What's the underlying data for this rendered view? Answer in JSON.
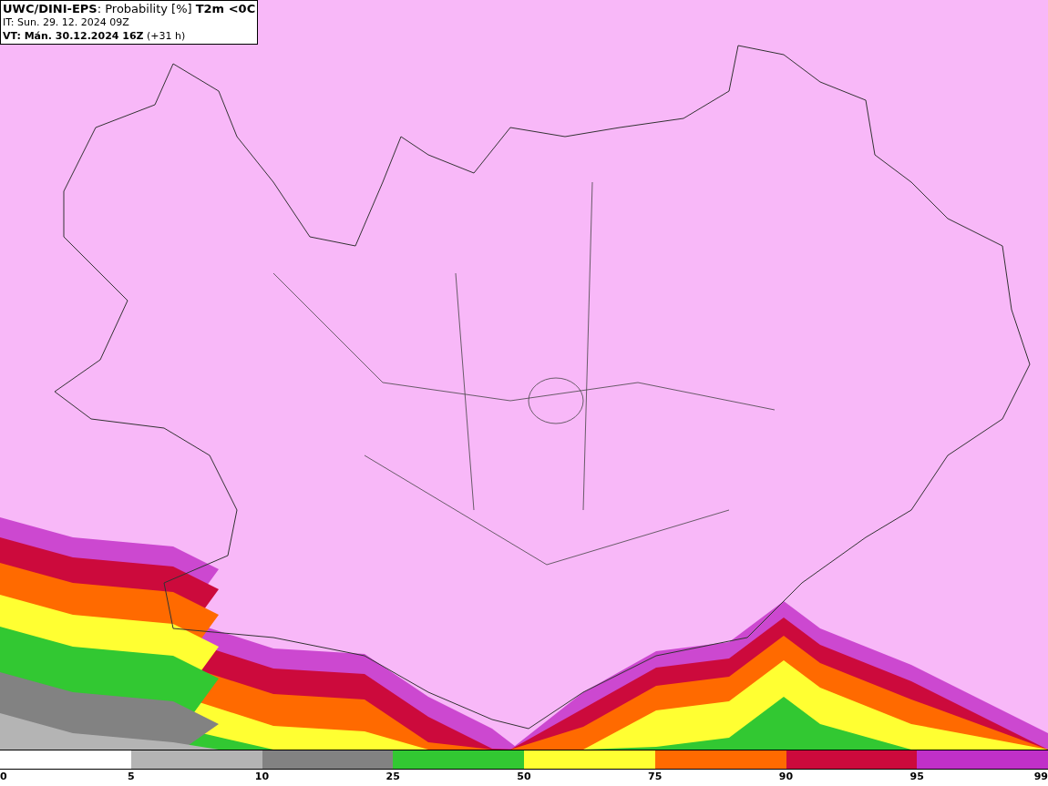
{
  "title_box": {
    "lines": [
      "**UWC/DINI-EPS**: Probability [%] **T2m <0C**",
      "IT: Sun. 29. 12. 2024 09Z",
      "**VT: Mán. 30.12.2024 16Z** (+31 h)"
    ]
  },
  "legend": {
    "segments": [
      {
        "label": "0",
        "color": "#ffffff"
      },
      {
        "label": "5",
        "color": "#b4b4b4"
      },
      {
        "label": "10",
        "color": "#828282"
      },
      {
        "label": "25",
        "color": "#32c832"
      },
      {
        "label": "50",
        "color": "#ffff32"
      },
      {
        "label": "75",
        "color": "#ff6a00"
      },
      {
        "label": "90",
        "color": "#cc0a3c"
      },
      {
        "label": "95",
        "color": "#c030c8"
      }
    ],
    "end_label": "99"
  }
}
